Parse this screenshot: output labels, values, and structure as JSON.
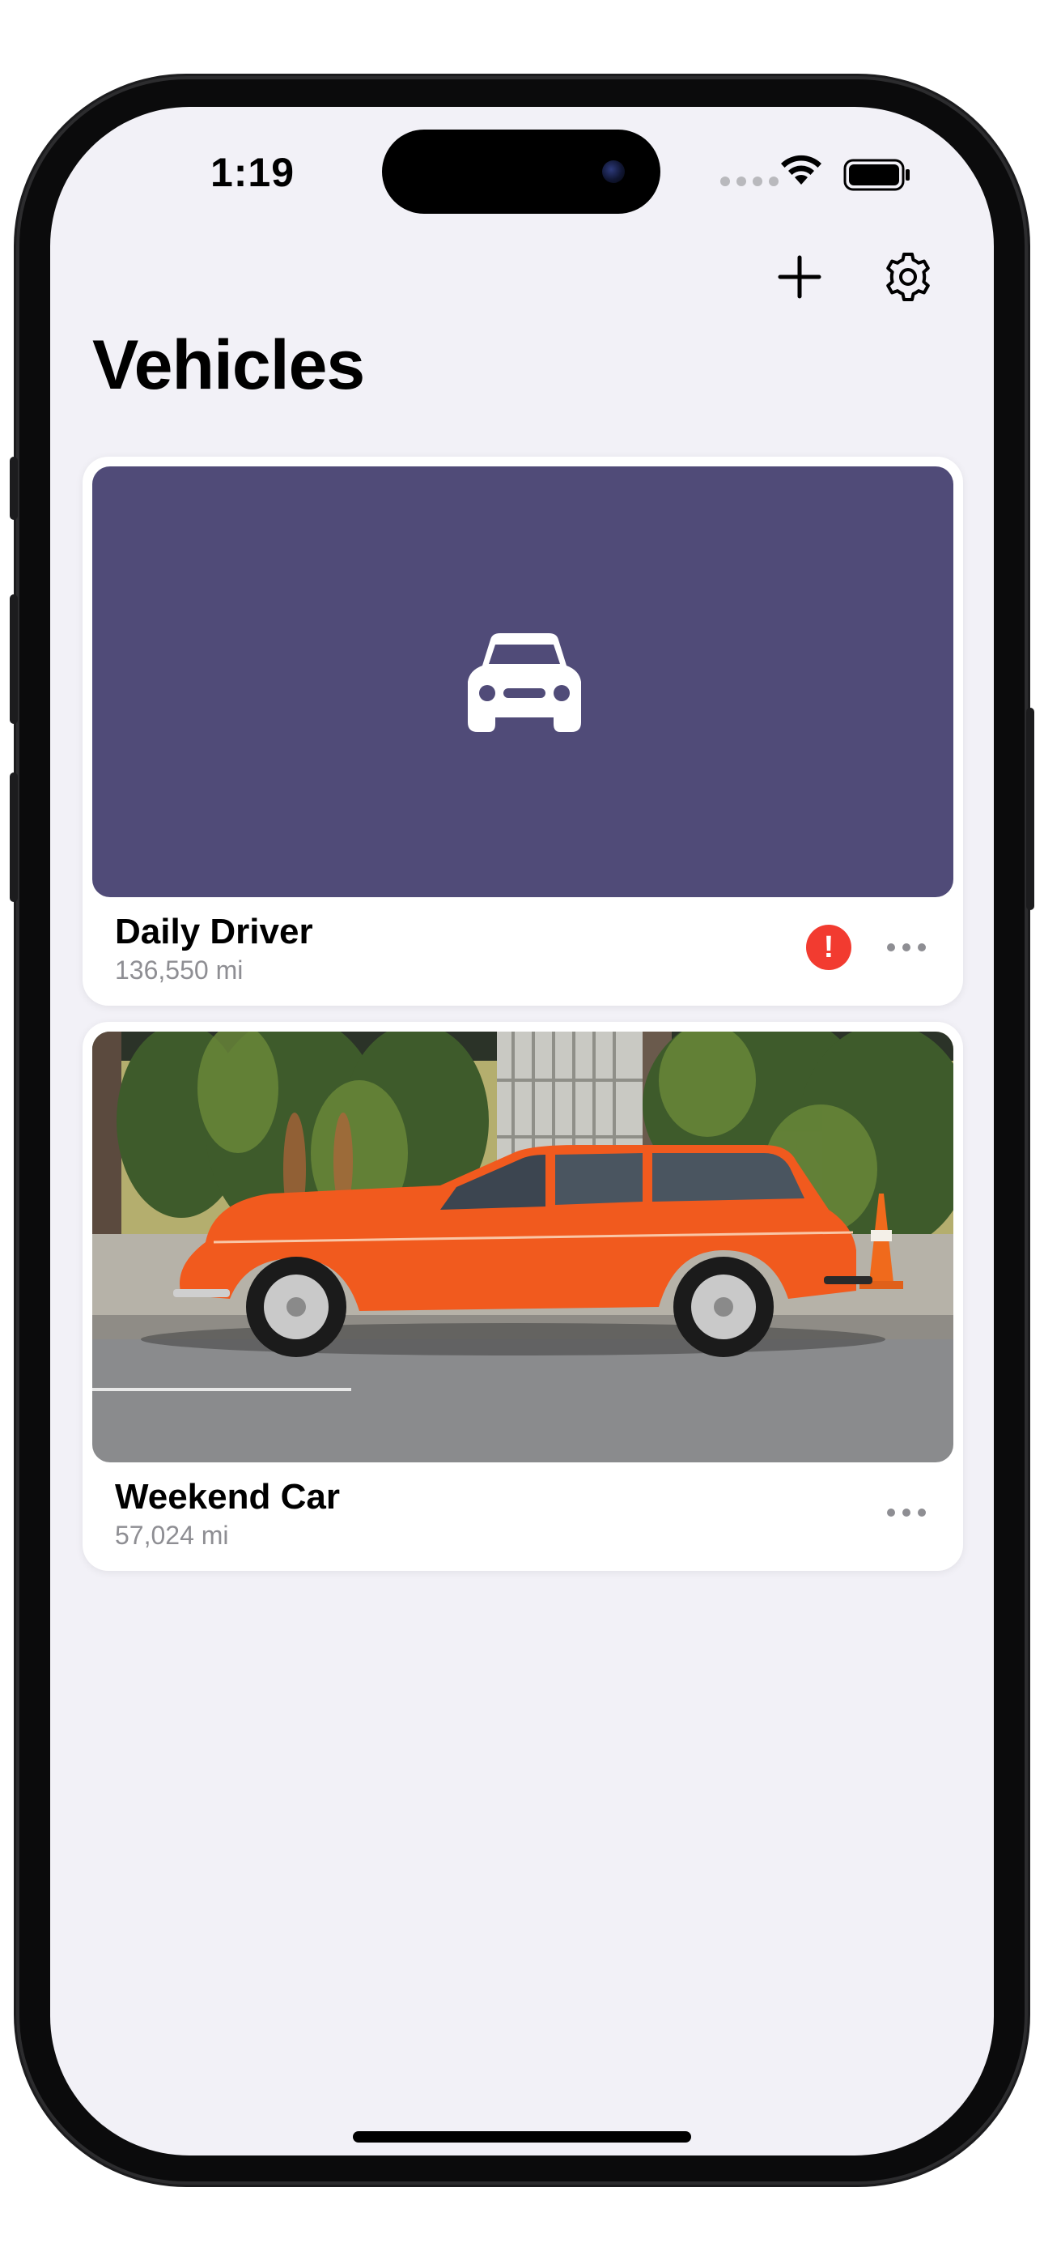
{
  "status_bar": {
    "time": "1:19"
  },
  "toolbar": {
    "add_icon": "plus-icon",
    "settings_icon": "gear-icon"
  },
  "page": {
    "title": "Vehicles"
  },
  "vehicles": [
    {
      "name": "Daily Driver",
      "mileage": "136,550 mi",
      "image": "car-placeholder-icon",
      "placeholder_color": "#504b78",
      "alert": true,
      "alert_symbol": "!"
    },
    {
      "name": "Weekend Car",
      "mileage": "57,024 mi",
      "image": "orange-station-wagon-photo",
      "alert": false
    }
  ],
  "colors": {
    "background": "#f2f1f7",
    "alert": "#f23b30",
    "secondary_text": "#8e8e93"
  }
}
